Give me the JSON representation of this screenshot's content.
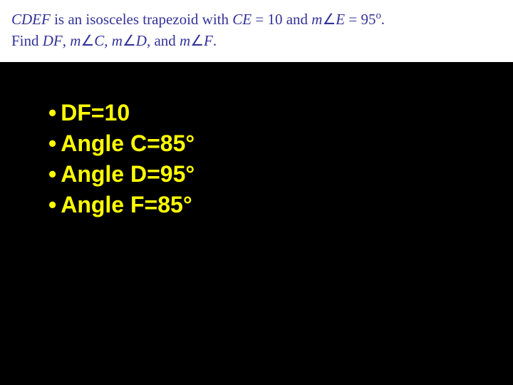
{
  "problem": {
    "line1_prefix": "CDEF",
    "line1_mid1": " is an isosceles trapezoid with ",
    "line1_ce_label": "CE",
    "line1_eq1": " = ",
    "line1_ce_val": " 10 ",
    "line1_and": "and ",
    "line1_m": "m",
    "line1_e": "E",
    "line1_eq2": " = ",
    "line1_e_val": " 95",
    "line1_end": ".",
    "line2_find": "Find ",
    "line2_df": "DF",
    "line2_c1": ", ",
    "line2_mC_m": "m",
    "line2_mC_v": "C",
    "line2_c2": ", ",
    "line2_mD_m": "m",
    "line2_mD_v": "D",
    "line2_c3": ", and ",
    "line2_mF_m": "m",
    "line2_mF_v": "F",
    "line2_end": "."
  },
  "answers": {
    "a1": "DF=10",
    "a2": "Angle C=85°",
    "a3": "Angle D=95°",
    "a4": "Angle F=85°"
  }
}
